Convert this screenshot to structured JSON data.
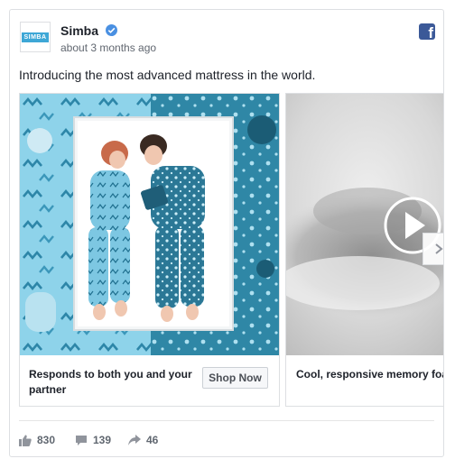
{
  "post": {
    "page_name": "Simba",
    "avatar_text": "SIMBA",
    "timestamp": "about 3 months ago",
    "caption": "Introducing the most advanced mattress in the world.",
    "icons": [
      "verified-badge-icon",
      "facebook-logo-icon",
      "like-icon",
      "comment-icon",
      "share-icon",
      "play-icon",
      "chevron-right-icon"
    ]
  },
  "carousel": {
    "cards": [
      {
        "title": "Responds to both you and your partner",
        "cta": "Shop Now"
      },
      {
        "title": "Cool, responsive memory foam"
      }
    ]
  },
  "stats": {
    "likes": "830",
    "comments": "139",
    "shares": "46"
  },
  "colors": {
    "accent": "#4a90e2",
    "facebook": "#3b5998",
    "brand": "#3ea7d6",
    "pattern_light": "#7fcbe6",
    "pattern_dark": "#2a7f9e"
  }
}
